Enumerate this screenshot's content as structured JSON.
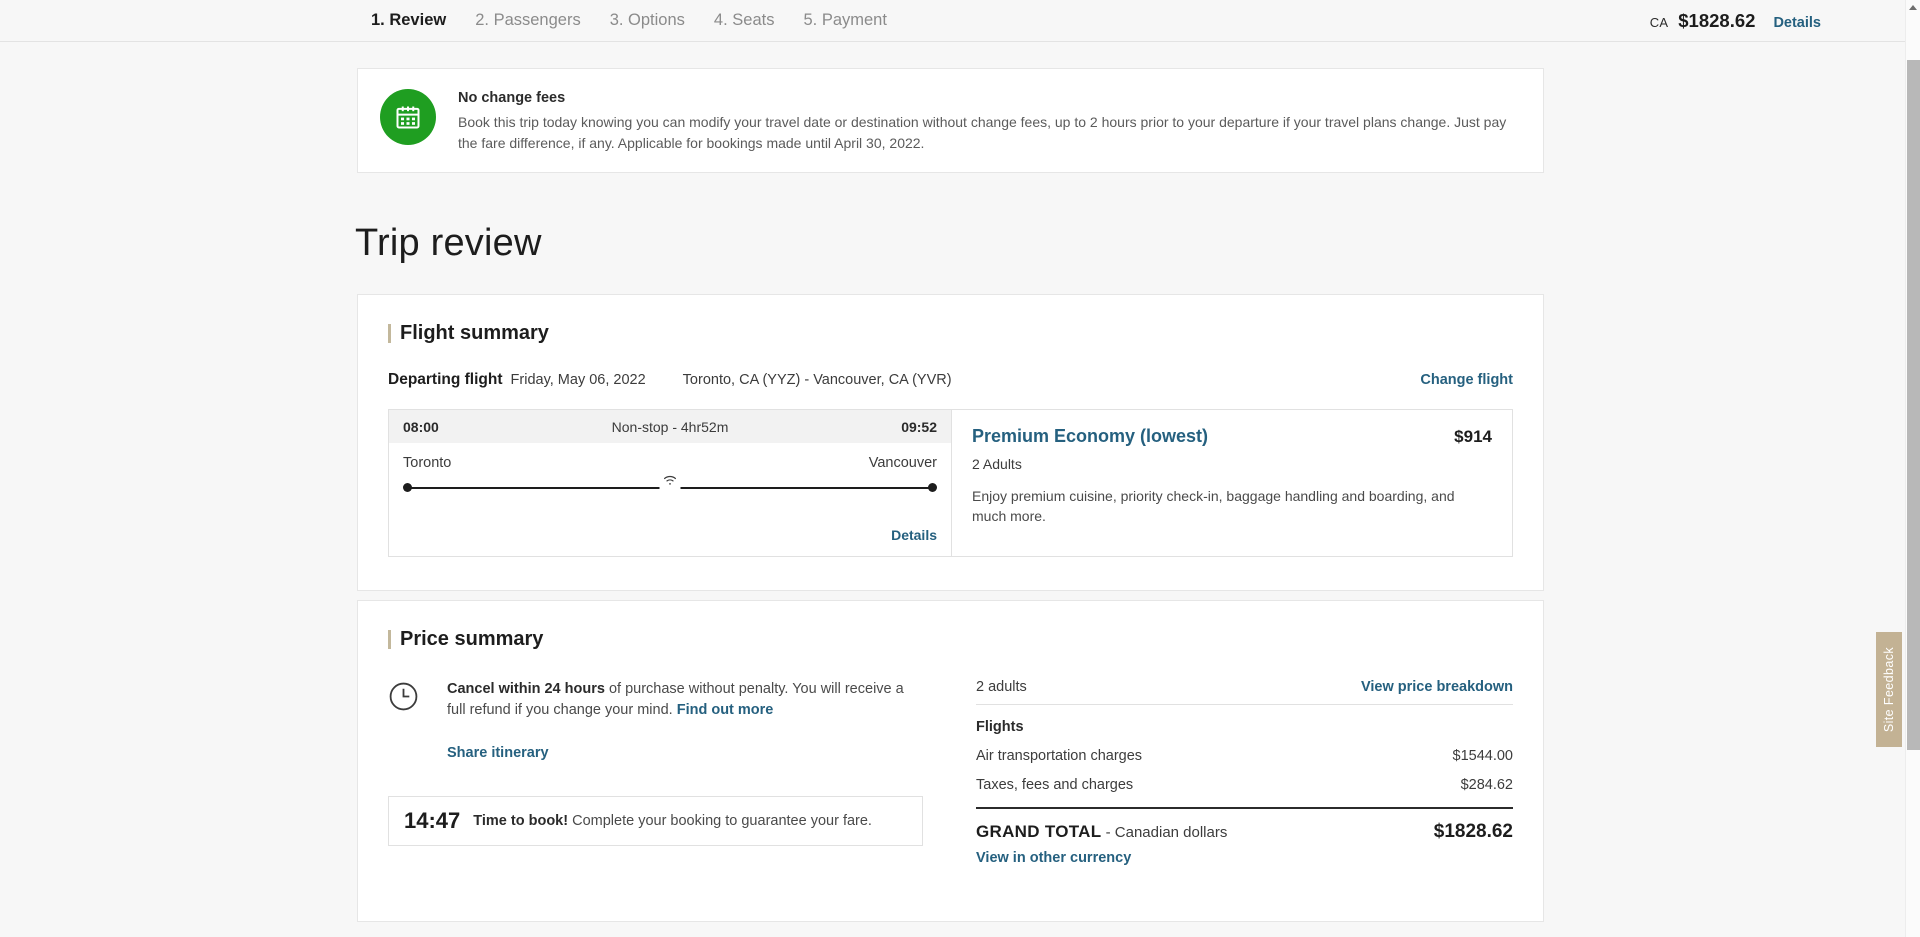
{
  "stepper": {
    "steps": [
      {
        "label": "1. Review",
        "active": true
      },
      {
        "label": "2. Passengers",
        "active": false
      },
      {
        "label": "3. Options",
        "active": false
      },
      {
        "label": "4. Seats",
        "active": false
      },
      {
        "label": "5. Payment",
        "active": false
      }
    ],
    "currency_code": "CA",
    "total_amount": "$1828.62",
    "details_label": "Details"
  },
  "banner": {
    "icon": "calendar-icon",
    "icon_color": "#1f9e21",
    "title": "No change fees",
    "body": "Book this trip today knowing you can modify your travel date or destination without change fees, up to 2 hours prior to your departure if your travel plans change. Just pay the fare difference, if any. Applicable for bookings made until April 30, 2022."
  },
  "page_title": "Trip review",
  "flight_summary": {
    "section_title": "Flight summary",
    "accent_color": "#c3b89c",
    "departing_label": "Departing flight",
    "departing_date": "Friday, May 06, 2022",
    "route": "Toronto, CA (YYZ) - Vancouver, CA (YVR)",
    "change_flight_label": "Change flight",
    "itinerary": {
      "depart_time": "08:00",
      "stops_duration": "Non-stop - 4hr52m",
      "arrive_time": "09:52",
      "origin_city": "Toronto",
      "destination_city": "Vancouver",
      "amenity_icon": "wifi-icon",
      "details_label": "Details"
    },
    "fare": {
      "cabin_name": "Premium Economy (lowest)",
      "price": "$914",
      "passengers": "2 Adults",
      "description": "Enjoy premium cuisine, priority check-in, baggage handling and boarding, and much more."
    }
  },
  "price_summary": {
    "section_title": "Price summary",
    "cancel_icon": "clock-icon",
    "cancel_bold": "Cancel within 24 hours",
    "cancel_rest": " of purchase without penalty. You will receive a full refund if you change your mind. ",
    "cancel_link": "Find out more",
    "share_itinerary_label": "Share itinerary",
    "timer_value": "14:47",
    "timer_bold": "Time to book!",
    "timer_rest": " Complete your booking to guarantee your fare.",
    "adults_label": "2 adults",
    "breakdown_link": "View price breakdown",
    "group_label": "Flights",
    "lines": [
      {
        "label": "Air transportation charges",
        "value": "$1544.00"
      },
      {
        "label": "Taxes, fees and charges",
        "value": "$284.62"
      }
    ],
    "grand_total_label": "GRAND TOTAL",
    "grand_total_currency": " - Canadian dollars",
    "grand_total_value": "$1828.62",
    "other_currency_link": "View in other currency"
  },
  "feedback_tab": {
    "label": "Site Feedback",
    "color": "#c3b294"
  }
}
